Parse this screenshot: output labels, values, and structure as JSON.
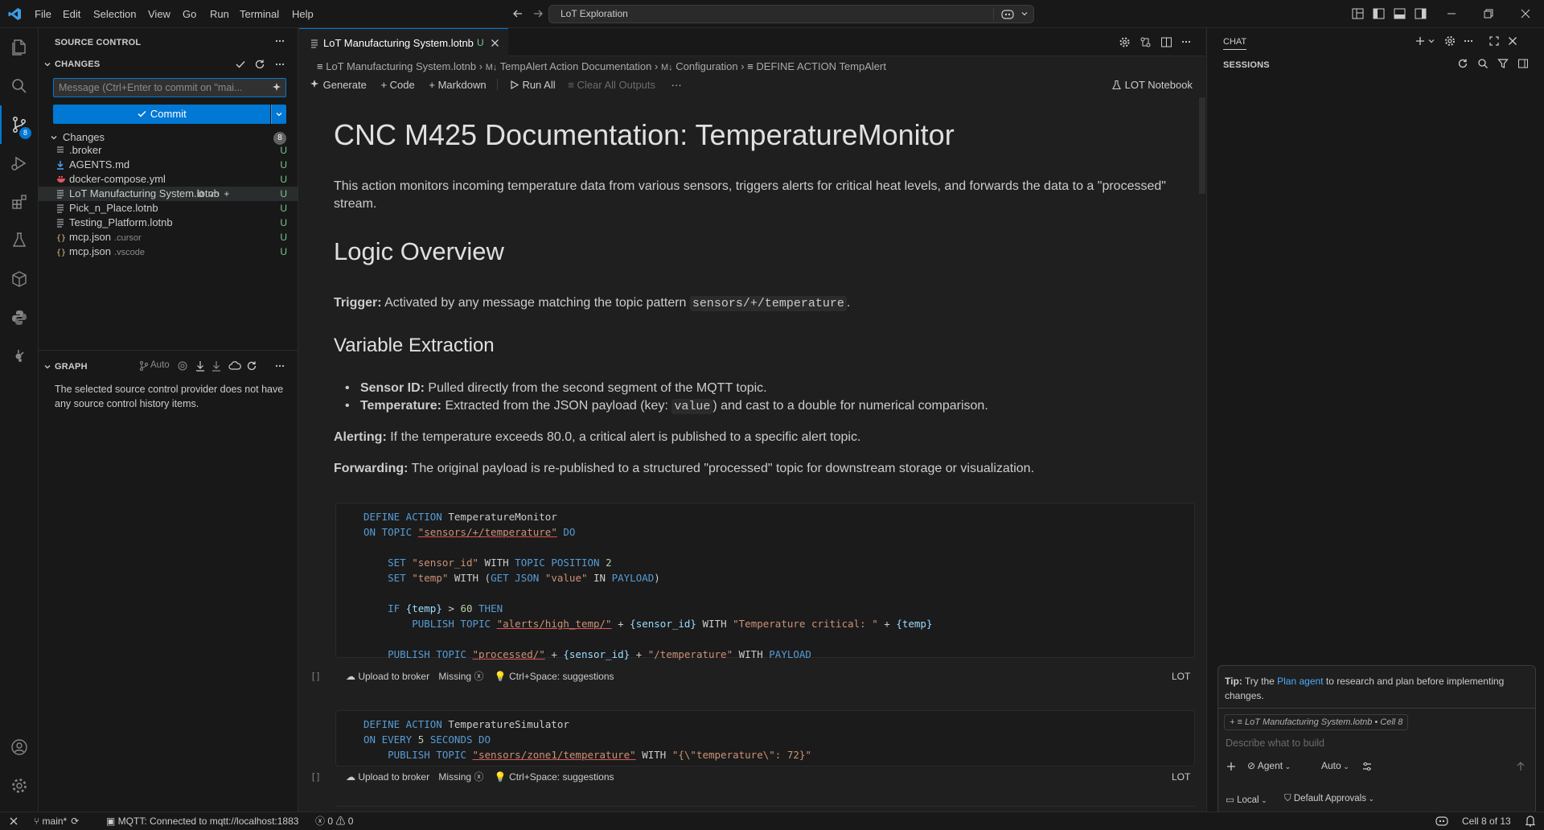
{
  "colors": {
    "accent": "#0078d4",
    "untracked": "#73c991",
    "keyword": "#569cd6",
    "string": "#ce9178",
    "link": "#4daafc"
  },
  "titlebar": {
    "menus": [
      "File",
      "Edit",
      "Selection",
      "View",
      "Go",
      "Run",
      "Terminal",
      "Help"
    ],
    "search": "LoT Exploration"
  },
  "sidebar": {
    "title": "SOURCE CONTROL",
    "changes_header": "CHANGES",
    "commit_placeholder": "Message (Ctrl+Enter to commit on \"mai...",
    "commit_label": "Commit",
    "changes_group": "Changes",
    "changes_count": "8",
    "files": [
      {
        "name": ".broker",
        "sub": "",
        "status": "U",
        "icon": "file-icon"
      },
      {
        "name": "AGENTS.md",
        "sub": "",
        "status": "U",
        "icon": "markdown-icon"
      },
      {
        "name": "docker-compose.yml",
        "sub": "",
        "status": "U",
        "icon": "docker-icon"
      },
      {
        "name": "LoT Manufacturing System.lotnb",
        "sub": "",
        "status": "U",
        "icon": "notebook-icon"
      },
      {
        "name": "Pick_n_Place.lotnb",
        "sub": "",
        "status": "U",
        "icon": "notebook-icon"
      },
      {
        "name": "Testing_Platform.lotnb",
        "sub": "",
        "status": "U",
        "icon": "notebook-icon"
      },
      {
        "name": "mcp.json",
        "sub": ".cursor",
        "status": "U",
        "icon": "json-icon"
      },
      {
        "name": "mcp.json",
        "sub": ".vscode",
        "status": "U",
        "icon": "json-icon"
      }
    ],
    "graph_title": "GRAPH",
    "graph_auto": "Auto",
    "graph_message": "The selected source control provider does not have any source control history items."
  },
  "activity_badge": "8",
  "editor": {
    "tab_label": "LoT Manufacturing System.lotnb",
    "tab_status": "U",
    "breadcrumb": [
      "LoT Manufacturing System.lotnb",
      "TempAlert Action Documentation",
      "Configuration",
      "DEFINE ACTION TempAlert"
    ],
    "toolbar": {
      "generate": "Generate",
      "code": "Code",
      "markdown": "Markdown",
      "run_all": "Run All",
      "clear_outputs": "Clear All Outputs",
      "kernel": "LOT Notebook"
    },
    "doc": {
      "h1": "CNC M425 Documentation: TemperatureMonitor",
      "intro": "This action monitors incoming temperature data from various sensors, triggers alerts for critical heat levels, and forwards the data to a \"processed\" stream.",
      "h2": "Logic Overview",
      "trigger_label": "Trigger:",
      "trigger_text": " Activated by any message matching the topic pattern ",
      "trigger_code": "sensors/+/temperature",
      "trigger_end": ".",
      "h3": "Variable Extraction",
      "b1_label": "Sensor ID:",
      "b1_text": " Pulled directly from the second segment of the MQTT topic.",
      "b2_label": "Temperature:",
      "b2_text_a": " Extracted from the JSON payload (key: ",
      "b2_code": "value",
      "b2_text_b": ") and cast to a double for numerical comparison.",
      "alert_label": "Alerting:",
      "alert_text": " If the temperature exceeds 80.0, a critical alert is published to a specific alert topic.",
      "fwd_label": "Forwarding:",
      "fwd_text": " The original payload is re-published to a structured \"processed\" topic for downstream storage or visualization."
    },
    "cell_footer": {
      "brackets": "[ ]",
      "upload": "Upload to broker",
      "missing": "Missing",
      "suggest": "Ctrl+Space: suggestions",
      "lang": "LOT"
    }
  },
  "chat": {
    "title": "CHAT",
    "sessions": "SESSIONS",
    "tip_label": "Tip:",
    "tip_a": " Try the ",
    "tip_link": "Plan agent",
    "tip_b": " to research and plan before implementing changes.",
    "context": "LoT Manufacturing System.lotnb • Cell 8",
    "input_placeholder": "Describe what to build",
    "agent": "Agent",
    "auto": "Auto",
    "local": "Local",
    "approvals": "Default Approvals"
  },
  "statusbar": {
    "branch": "main*",
    "mqtt": "MQTT: Connected to mqtt://localhost:1883",
    "errors": "0",
    "warnings": "0",
    "cell": "Cell 8 of 13"
  }
}
